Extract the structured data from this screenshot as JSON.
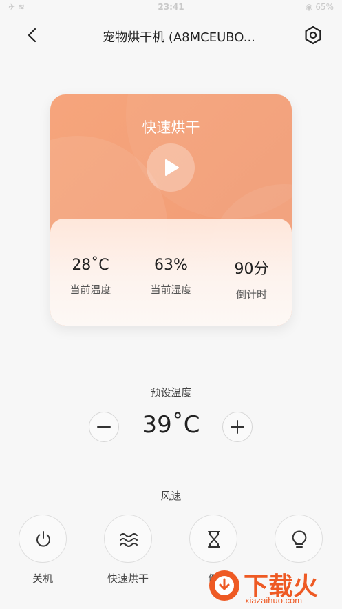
{
  "status_bar": {
    "time": "23:41",
    "left": "✈ ≋",
    "battery": "◉ 65%"
  },
  "header": {
    "title": "宠物烘干机 (A8MCEUBO..."
  },
  "mode_card": {
    "title": "快速烘干",
    "stats": [
      {
        "value": "28˚C",
        "label": "当前温度"
      },
      {
        "value": "63%",
        "label": "当前湿度"
      },
      {
        "value": "90分",
        "label": "倒计时"
      }
    ]
  },
  "preset": {
    "label": "预设温度",
    "value": "39˚C"
  },
  "wind": {
    "label": "风速"
  },
  "functions": [
    {
      "label": "关机",
      "icon": "power-icon"
    },
    {
      "label": "快速烘干",
      "icon": "wind-waves-icon"
    },
    {
      "label": "倒",
      "icon": "hourglass-icon"
    },
    {
      "label": "",
      "icon": "light-bulb-icon"
    }
  ],
  "watermark": {
    "text": "下载火",
    "sub": "xiazaihuo.com"
  }
}
